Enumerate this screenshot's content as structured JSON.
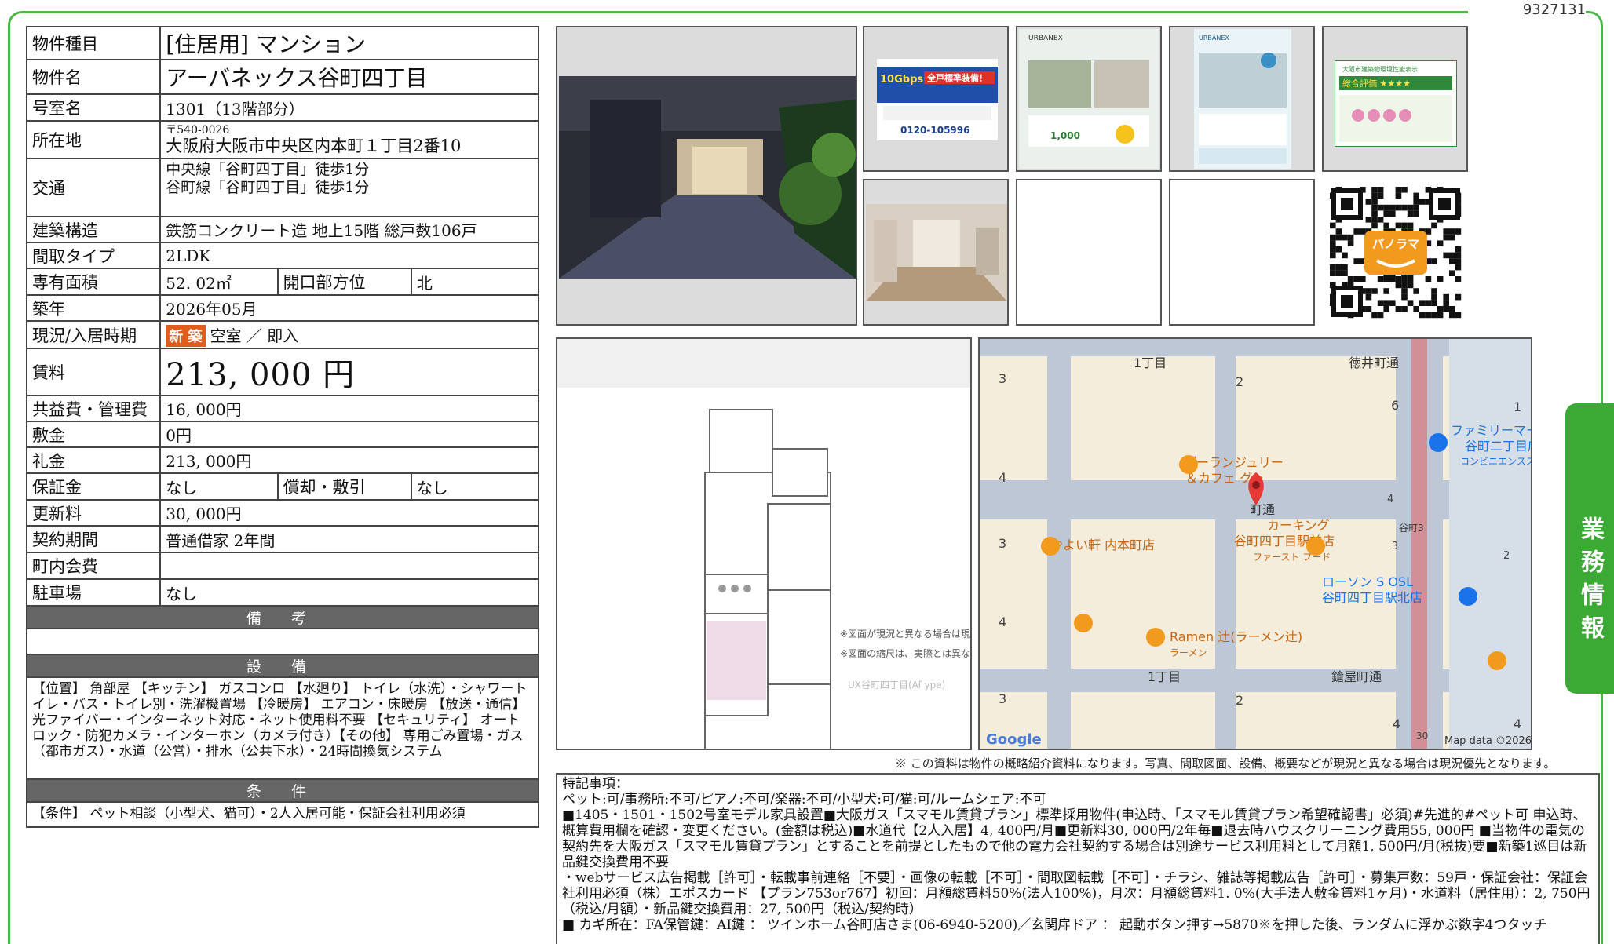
{
  "ref_no": "9327131",
  "property": {
    "type_label": "物件種目",
    "type_value": "[住居用]  マンション",
    "name_label": "物件名",
    "name_value": "アーバネックス谷町四丁目",
    "room_label": "号室名",
    "room_value": "1301（13階部分）",
    "location_label": "所在地",
    "zip": "〒540-0026",
    "address": "大阪府大阪市中央区内本町１丁目2番10",
    "transport_label": "交通",
    "transport_line1": "中央線「谷町四丁目」徒歩1分",
    "transport_line2": "谷町線「谷町四丁目」徒歩1分",
    "structure_label": "建築構造",
    "structure_value": "鉄筋コンクリート造 地上15階 総戸数106戸",
    "layout_label": "間取タイプ",
    "layout_value": "2LDK",
    "area_label": "専有面積",
    "area_value": "52. 02㎡",
    "direction_label": "開口部方位",
    "direction_value": "北",
    "built_label": "築年",
    "built_value": "2026年05月",
    "status_label": "現況/入居時期",
    "status_badge": "新 築",
    "status_value": "空室 ／ 即入",
    "rent_label": "賃料",
    "rent_value": "213, 000 円",
    "fee_label": "共益費・管理費",
    "fee_value": "16, 000円",
    "deposit_label": "敷金",
    "deposit_value": "0円",
    "key_money_label": "礼金",
    "key_money_value": "213, 000円",
    "guarantee_label": "保証金",
    "guarantee_value": "なし",
    "amort_label": "償却・敷引",
    "amort_value": "なし",
    "renewal_label": "更新料",
    "renewal_value": "30, 000円",
    "contract_label": "契約期間",
    "contract_value": "普通借家 2年間",
    "community_label": "町内会費",
    "community_value": "",
    "parking_label": "駐車場",
    "parking_value": "なし",
    "remarks_head": "備 考",
    "facilities_head": "設 備",
    "facilities_text": "【位置】 角部屋 【キッチン】 ガスコンロ 【水廻り】 トイレ（水洗）・シャワートイレ・バス・トイレ別・洗濯機置場 【冷暖房】 エアコン・床暖房 【放送・通信】 光ファイバー・インターネット対応・ネット使用料不要 【セキュリティ】 オートロック・防犯カメラ・インターホン（カメラ付き）【その他】 専用ごみ置場・ガス（都市ガス）・水道（公営）・排水（公共下水）・24時間換気システム",
    "conditions_head": "条 件",
    "conditions_text": "【条件】 ペット相談（小型犬、猫可）・2人入居可能・保証会社利用必須"
  },
  "photos": {
    "flyer1_text": "全戸標準装備！",
    "flyer1_speed": "10Gbps",
    "flyer1_phone": "0120-105996",
    "flyer2_brand": "URBANEX",
    "flyer2_amount": "1,000",
    "flyer3_brand": "URBANEX",
    "flyer4_title": "大阪市建築物環境性能表示",
    "flyer4_rating": "総合評価 ★★★★",
    "qr_label": "パノラマ"
  },
  "floorplan": {
    "note1": "※図面が現況と異なる場合は現況優先とします。",
    "note2": "※図面の縮尺は、実際とは異なります。",
    "caption": "UX谷町四丁目(Af ype)"
  },
  "map": {
    "labels": [
      "1丁目",
      "徳井町通",
      "ファミリーマート",
      "谷町二丁目店",
      "コンビニエンスストア",
      "ブーランジュリー",
      "＆カフェ グゥ",
      "町通",
      "カーキング",
      "谷町四丁目駅前店",
      "ファースト フード",
      "やよい軒 内本町店",
      "ローソン S OSL",
      "谷町四丁目駅北店",
      "Ramen 辻(ラーメン辻)",
      "ラーメン",
      "1丁目",
      "鎗屋町通",
      "谷町3",
      "Google",
      "Map data ©2026"
    ],
    "block_numbers": [
      "3",
      "2",
      "6",
      "1",
      "4",
      "3",
      "4",
      "3",
      "2",
      "4",
      "4",
      "3",
      "2",
      "4",
      "3",
      "30"
    ]
  },
  "notice": "※ この資料は物件の概略紹介資料になります。写真、間取図面、設備、概要などが現況と異なる場合は現況優先となります。",
  "remarks": {
    "title": "特記事項：",
    "line1": "ペット:可/事務所:不可/ピアノ:不可/楽器:不可/小型犬:可/猫:可/ルームシェア:不可",
    "body": "■1405・1501・1502号室モデル家具設置■大阪ガス「スマモル賃貸プラン」標準採用物件(申込時、「スマモル賃貸プラン希望確認書」必須)#先進的#ペット可 申込時、概算費用欄を確認・変更ください。(金額は税込)■水道代【2人入居】4, 400円/月■更新料30, 000円/2年毎■退去時ハウスクリーニング費用55, 000円 ■当物件の電気の契約先を大阪ガス「スマモル賃貸プラン」とすることを前提としたもので他の電力会社契約する場合は別途サービス利用料として月額1, 500円/月(税抜)要■新築1巡目は新品鍵交換費用不要",
    "line3": "・webサービス広告掲載［許可］・転載事前連絡［不要］・画像の転載［不可］・間取図転載［不可］・チラシ、雑誌等掲載広告［許可］・募集戸数：59戸・保証会社：保証会社利用必須（株）エポスカード 【プラン753or767】初回：月額総賃料50%(法人100%)，月次：月額総賃料1. 0%(大手法人敷金賃料1ヶ月)・水道料（居住用）：2, 750円（税込/月額）・新品鍵交換費用：27, 500円（税込/契約時）",
    "line4": "■ カギ所在：FA保管鍵：AI鍵 ： ツインホーム谷町店さま(06-6940-5200)／玄関扉ドア ： 起動ボタン押す→5870※を押した後、ランダムに浮かぶ数字4つタッチ"
  },
  "side_tab": "業務情報"
}
